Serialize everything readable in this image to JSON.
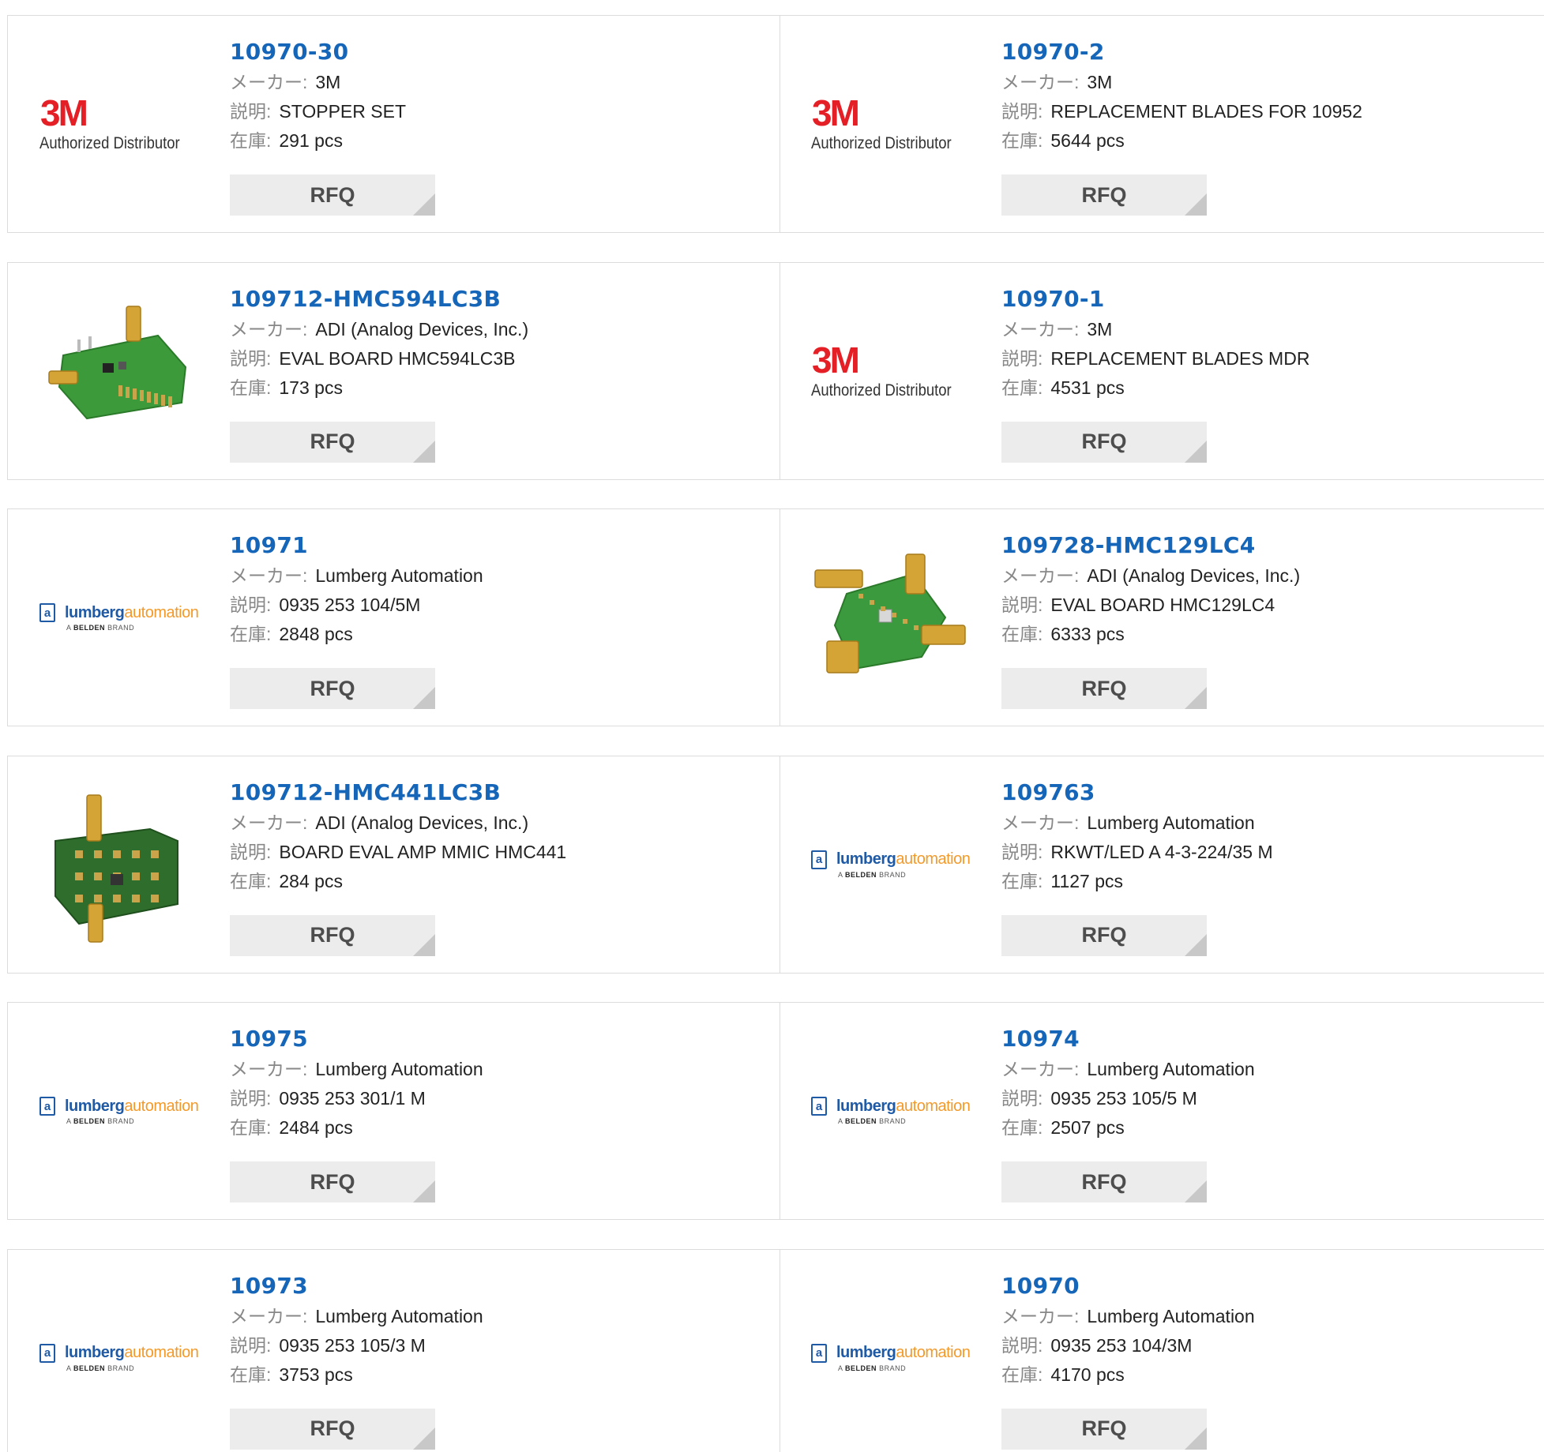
{
  "labels": {
    "maker": "メーカー:",
    "description": "説明:",
    "stock": "在庫:",
    "rfq": "RFQ"
  },
  "logos": {
    "m3": {
      "mark": "3M",
      "sub": "Authorized Distributor"
    },
    "lumberg": {
      "box": "a",
      "word_a": "lumberg",
      "word_b": "automation",
      "tag_a": "A",
      "tag_b": "BELDEN",
      "tag_c": "BRAND"
    }
  },
  "colors": {
    "part_number": "#1565b8",
    "m3_red": "#e41f26",
    "lumberg_blue": "#1f5aa6",
    "lumberg_orange": "#f39a2a",
    "rfq_bg": "#ececec"
  },
  "products": [
    {
      "part": "10970-30",
      "maker": "3M",
      "desc": "STOPPER SET",
      "stock": "291 pcs",
      "image": "3m-logo"
    },
    {
      "part": "10970-2",
      "maker": "3M",
      "desc": "REPLACEMENT BLADES FOR 10952",
      "stock": "5644 pcs",
      "image": "3m-logo"
    },
    {
      "part": "109712-HMC594LC3B",
      "maker": "ADI (Analog Devices, Inc.)",
      "desc": "EVAL BOARD HMC594LC3B",
      "stock": "173 pcs",
      "image": "eval-board-a"
    },
    {
      "part": "10970-1",
      "maker": "3M",
      "desc": "REPLACEMENT BLADES MDR",
      "stock": "4531 pcs",
      "image": "3m-logo"
    },
    {
      "part": "10971",
      "maker": "Lumberg Automation",
      "desc": "0935 253 104/5M",
      "stock": "2848 pcs",
      "image": "lumberg-logo"
    },
    {
      "part": "109728-HMC129LC4",
      "maker": "ADI (Analog Devices, Inc.)",
      "desc": "EVAL BOARD HMC129LC4",
      "stock": "6333 pcs",
      "image": "eval-board-b"
    },
    {
      "part": "109712-HMC441LC3B",
      "maker": "ADI (Analog Devices, Inc.)",
      "desc": "BOARD EVAL AMP MMIC HMC441",
      "stock": "284 pcs",
      "image": "eval-board-c"
    },
    {
      "part": "109763",
      "maker": "Lumberg Automation",
      "desc": "RKWT/LED A 4-3-224/35 M",
      "stock": "1127 pcs",
      "image": "lumberg-logo"
    },
    {
      "part": "10975",
      "maker": "Lumberg Automation",
      "desc": "0935 253 301/1 M",
      "stock": "2484 pcs",
      "image": "lumberg-logo"
    },
    {
      "part": "10974",
      "maker": "Lumberg Automation",
      "desc": "0935 253 105/5 M",
      "stock": "2507 pcs",
      "image": "lumberg-logo"
    },
    {
      "part": "10973",
      "maker": "Lumberg Automation",
      "desc": "0935 253 105/3 M",
      "stock": "3753 pcs",
      "image": "lumberg-logo"
    },
    {
      "part": "10970",
      "maker": "Lumberg Automation",
      "desc": "0935 253 104/3M",
      "stock": "4170 pcs",
      "image": "lumberg-logo"
    }
  ]
}
